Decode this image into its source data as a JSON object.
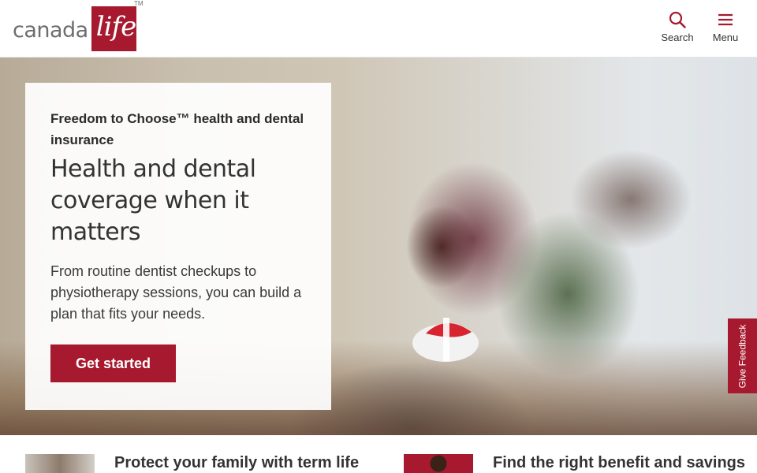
{
  "header": {
    "logo_word": "canada",
    "logo_script": "life",
    "logo_tm": "TM",
    "search_label": "Search",
    "menu_label": "Menu"
  },
  "hero": {
    "eyebrow": "Freedom to Choose™ health and dental insurance",
    "title": "Health and dental coverage when it matters",
    "description": "From routine dentist checkups to physiotherapy sessions, you can build a plan that fits your needs.",
    "cta_label": "Get started"
  },
  "feedback_label": "Give Feedback",
  "teasers": [
    {
      "title": "Protect your family with term life"
    },
    {
      "title": "Find the right benefit and savings"
    }
  ],
  "colors": {
    "brand": "#a6192e",
    "text": "#2b2b2b"
  },
  "icons": {
    "search": "search-icon",
    "menu": "hamburger-icon"
  }
}
